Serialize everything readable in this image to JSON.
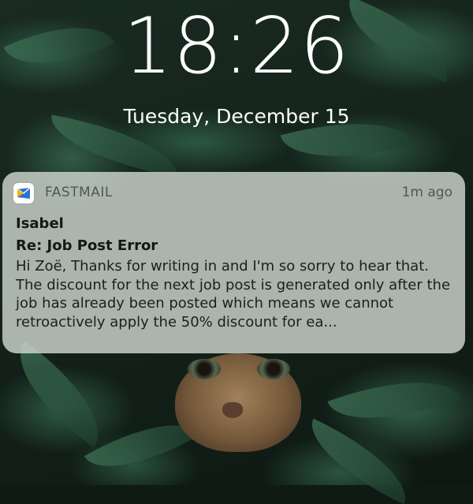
{
  "lock_screen": {
    "time": "18:26",
    "date": "Tuesday, December 15"
  },
  "notification": {
    "app_icon": "fastmail-icon",
    "app_name": "FASTMAIL",
    "timestamp": "1m ago",
    "sender": "Isabel",
    "subject": "Re: Job Post Error",
    "body": "Hi Zoë, Thanks for writing in and I'm so sorry to hear that. The discount for the next job post is generated only after the job has already been posted which means we cannot retroactively apply the 50% discount for ea..."
  },
  "colors": {
    "fastmail_blue": "#2d6fd6",
    "fastmail_yellow": "#f5b400",
    "notification_bg": "#cdd6ce"
  }
}
